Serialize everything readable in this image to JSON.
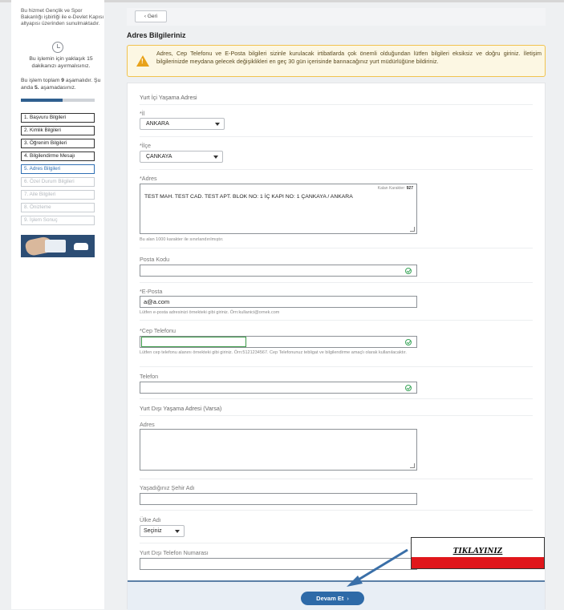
{
  "sidebar": {
    "intro": "Bu hizmet Gençlik ve Spor Bakanlığı işbirliği ile e-Devlet Kapısı altyapısı üzerinden sunulmaktadır.",
    "time_text": "Bu işlemin için yaklaşık 15 dakikanızı ayırmalısınız.",
    "step_info_prefix": "Bu işlem toplam",
    "step_total": "9",
    "step_info_mid": "aşamalıdır. Şu anda",
    "step_current": "5.",
    "step_info_suffix": "aşamadasınız.",
    "progress_fraction": 0.56,
    "steps": [
      {
        "label": "1. Başvuru Bilgileri",
        "state": "done"
      },
      {
        "label": "2. Kimlik Bilgileri",
        "state": "done"
      },
      {
        "label": "3. Öğrenim Bilgileri",
        "state": "done"
      },
      {
        "label": "4. Bilgilendirme Mesajı",
        "state": "done"
      },
      {
        "label": "5. Adres Bilgileri",
        "state": "current"
      },
      {
        "label": "6. Özel Durum Bilgileri",
        "state": "pending"
      },
      {
        "label": "7. Aile Bilgileri",
        "state": "pending"
      },
      {
        "label": "8. Önizleme",
        "state": "pending"
      },
      {
        "label": "9. İşlem Sonuç",
        "state": "pending"
      }
    ]
  },
  "main": {
    "back_label": "Geri",
    "page_title": "Adres Bilgileriniz",
    "alert_text": "Adres, Cep Telefonu ve E-Posta bilgileri sizinle kurulacak irtibatlarda çok önemli olduğundan lütfen bilgileri eksiksiz ve doğru giriniz. İletişim bilgilerinizde meydana gelecek değişiklikleri en geç 30 gün içerisinde bannacağınız yurt müdürlüğüne bildiriniz."
  },
  "form": {
    "domestic_title": "Yurt İçi Yaşama Adresi",
    "il_label": "*İl",
    "il_value": "ANKARA",
    "ilce_label": "*İlçe",
    "ilce_value": "ÇANKAYA",
    "adres_label": "*Adres",
    "counter_label": "Kalan Karakter:",
    "counter_value": "927",
    "adres_value": "TEST MAH. TEST CAD. TEST APT. BLOK  NO: 1  İÇ KAPI NO: 1 ÇANKAYA / ANKARA",
    "adres_hint": "Bu alan 1000 karakter ile sınırlandırılmıştır.",
    "posta_label": "Posta Kodu",
    "posta_value": "",
    "eposta_label": "*E-Posta",
    "eposta_value": "a@a.com",
    "eposta_hint": "Lütfen e-posta adresinizi örnekteki gibi giriniz. Örn:kullanici@ornek.com",
    "cep_label": "*Cep Telefonu",
    "cep_value": "",
    "cep_hint": "Lütfen cep telefonu alanını örnekteki gibi giriniz. Örn:5121234567. Cep Telefonunuz tebligat ve bilgilendirme amaçlı olarak kullanılacaktır.",
    "telefon_label": "Telefon",
    "telefon_value": "",
    "abroad_title": "Yurt Dışı Yaşama Adresi (Varsa)",
    "abroad_adres_label": "Adres",
    "sehir_label": "Yaşadığınız Şehir Adı",
    "ulke_label": "Ülke Adı",
    "ulke_value": "Seçiniz",
    "yd_tel_label": "Yurt Dışı Telefon Numarası",
    "devam_label": "Devam Et",
    "devam_icon": "chevron-right-icon"
  },
  "annotation": {
    "label": "TIKLAYINIZ",
    "color": "#e0161b"
  }
}
